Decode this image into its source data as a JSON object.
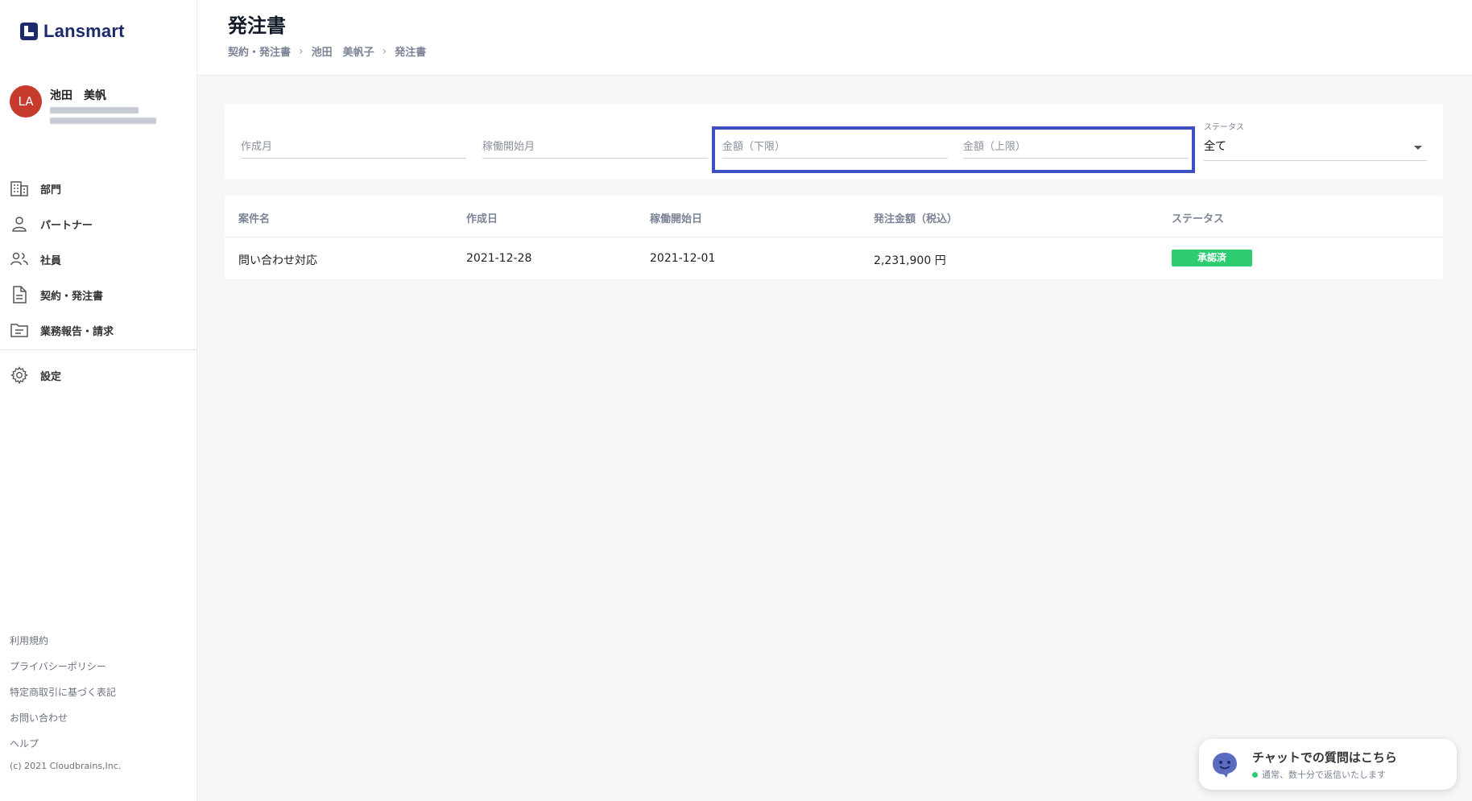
{
  "brand": {
    "name": "Lansmart",
    "color": "#1c2a6b"
  },
  "user": {
    "initials": "LA",
    "name": "池田　美帆",
    "avatar_color": "#c73b2f"
  },
  "nav": {
    "items": [
      {
        "label": "部門",
        "icon": "building-icon"
      },
      {
        "label": "パートナー",
        "icon": "person-icon"
      },
      {
        "label": "社員",
        "icon": "people-icon"
      },
      {
        "label": "契約・発注書",
        "icon": "document-icon"
      },
      {
        "label": "業務報告・請求",
        "icon": "folder-icon"
      }
    ],
    "settings": {
      "label": "設定",
      "icon": "gear-icon"
    }
  },
  "footer": {
    "links": [
      "利用規約",
      "プライバシーポリシー",
      "特定商取引に基づく表記",
      "お問い合わせ",
      "ヘルプ"
    ],
    "copyright": "(c) 2021 Cloudbrains,Inc."
  },
  "header": {
    "title": "発注書",
    "breadcrumb": [
      "契約・発注書",
      "池田　美帆子",
      "発注書"
    ]
  },
  "filters": {
    "created_month_placeholder": "作成月",
    "start_month_placeholder": "稼働開始月",
    "amount_min_placeholder": "金額（下限）",
    "amount_max_placeholder": "金額（上限）",
    "status_caption": "ステータス",
    "status_value": "全て"
  },
  "table": {
    "headers": [
      "案件名",
      "作成日",
      "稼働開始日",
      "発注金額（税込）",
      "ステータス"
    ],
    "rows": [
      {
        "project": "問い合わせ対応",
        "created": "2021-12-28",
        "start": "2021-12-01",
        "amount": "2,231,900 円",
        "status": "承認済"
      }
    ]
  },
  "colors": {
    "accent": "#3f4fc8",
    "approved": "#2ecc71"
  },
  "chat": {
    "title": "チャットでの質問はこちら",
    "subtitle": "通常、数十分で返信いたします"
  }
}
